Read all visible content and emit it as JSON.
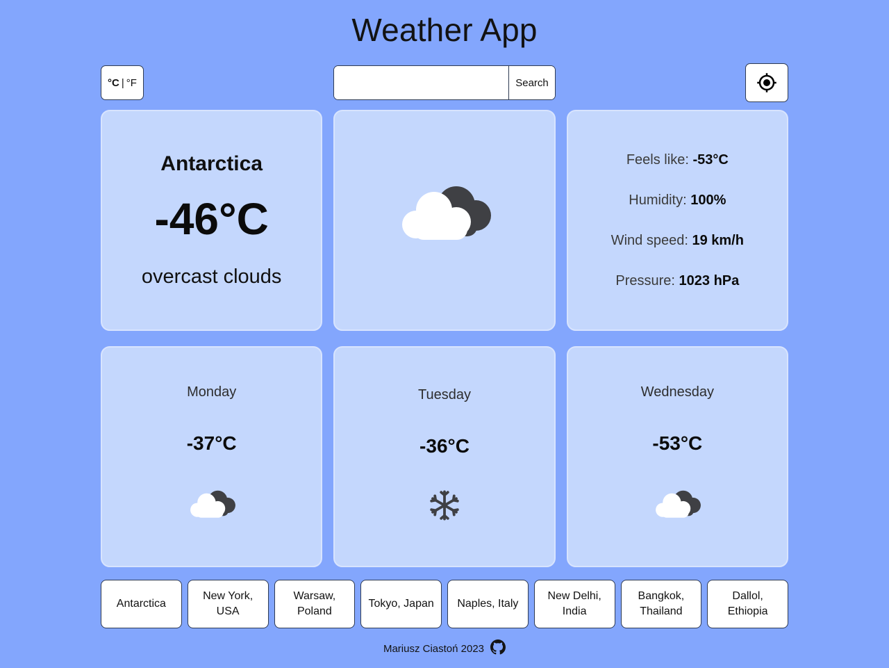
{
  "header": {
    "title": "Weather App"
  },
  "controls": {
    "unit_toggle": {
      "celsius": "°C",
      "separator": "|",
      "fahrenheit": "°F",
      "active": "celsius"
    },
    "search": {
      "value": "",
      "placeholder": "",
      "button_label": "Search"
    },
    "geolocate": {
      "icon": "my-location-icon",
      "label": ""
    }
  },
  "current": {
    "city": "Antarctica",
    "temperature": "-46°C",
    "description": "overcast clouds",
    "icon": "overcast-clouds-icon",
    "icon_glyph": "☁️"
  },
  "details": [
    {
      "label": "Feels like:",
      "value": "-53°C"
    },
    {
      "label": "Humidity:",
      "value": "100%"
    },
    {
      "label": "Wind speed:",
      "value": "19 km/h"
    },
    {
      "label": "Pressure:",
      "value": "1023 hPa"
    }
  ],
  "forecast": [
    {
      "day": "Monday",
      "temperature": "-37°C",
      "icon": "overcast-clouds-icon",
      "icon_glyph": "☁️"
    },
    {
      "day": "Tuesday",
      "temperature": "-36°C",
      "icon": "snowflake-icon",
      "icon_glyph": "❄️"
    },
    {
      "day": "Wednesday",
      "temperature": "-53°C",
      "icon": "overcast-clouds-icon",
      "icon_glyph": "☁️"
    }
  ],
  "cities": [
    "Antarctica",
    "New York, USA",
    "Warsaw, Poland",
    "Tokyo, Japan",
    "Naples, Italy",
    "New Delhi, India",
    "Bangkok, Thailand",
    "Dallol, Ethiopia"
  ],
  "footer": {
    "credit": "Mariusz Ciastoń 2023",
    "icon": "github-icon"
  },
  "colors": {
    "background": "#83a6fd",
    "card": "#c4d7fd",
    "card_border": "#d8e4fe",
    "button_background": "#ffffff",
    "button_border": "#2f3b52",
    "text": "#111111",
    "muted_text": "#3b3b3b",
    "cloud_dark": "#3f4044",
    "cloud_light": "#ffffff"
  }
}
